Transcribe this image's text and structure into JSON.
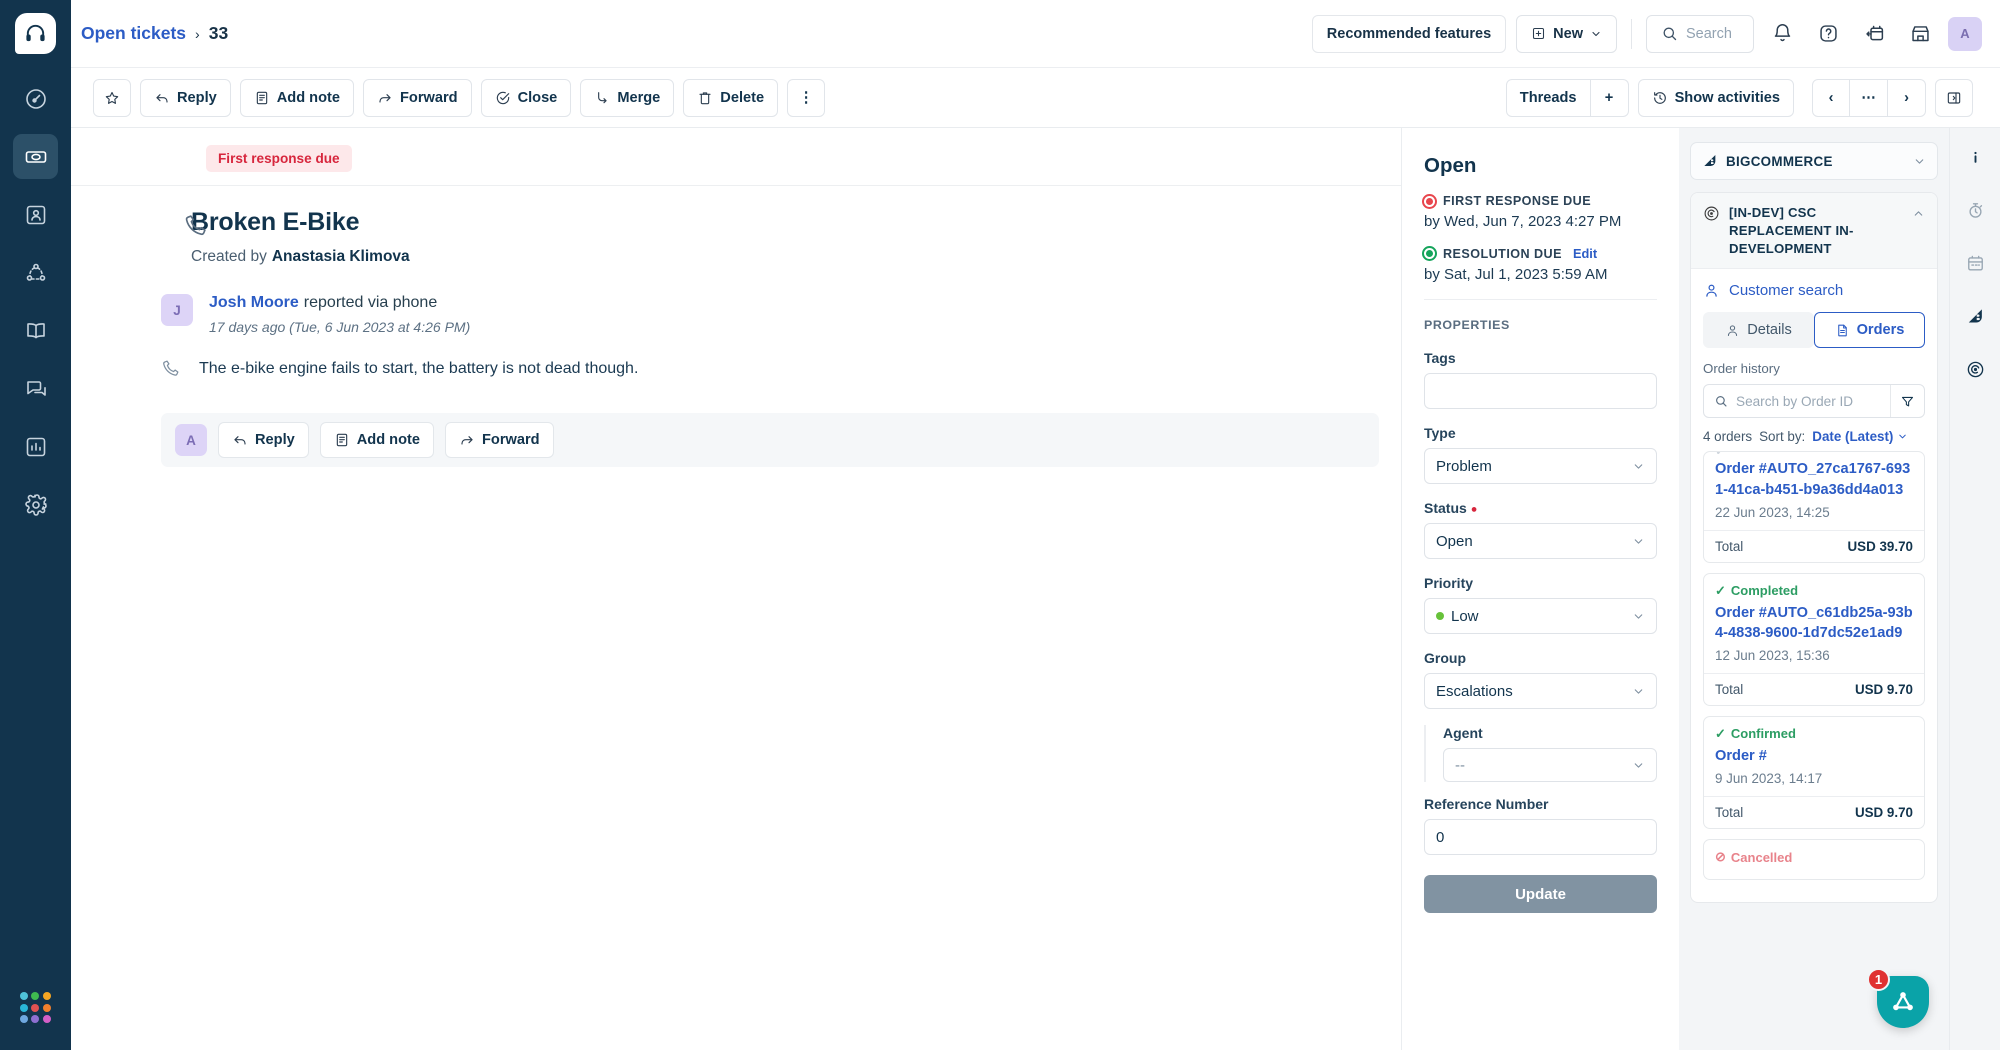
{
  "colors": {
    "brand_navy": "#12344d",
    "link_blue": "#2c5cc5",
    "danger_red": "#d7263d",
    "success_green": "#15a45b",
    "fab_teal": "#0aa3a8",
    "badge_red": "#e03131"
  },
  "sidebar": {
    "logo_icon": "headset-icon",
    "items": [
      {
        "name": "dashboard",
        "icon": "speedometer-icon",
        "active": false
      },
      {
        "name": "tickets",
        "icon": "ticket-icon",
        "active": true
      },
      {
        "name": "contacts",
        "icon": "contact-card-icon",
        "active": false
      },
      {
        "name": "customers",
        "icon": "network-icon",
        "active": false
      },
      {
        "name": "solutions",
        "icon": "book-icon",
        "active": false
      },
      {
        "name": "chat",
        "icon": "chat-bubbles-icon",
        "active": false
      },
      {
        "name": "analytics",
        "icon": "bar-chart-icon",
        "active": false
      },
      {
        "name": "admin",
        "icon": "gear-icon",
        "active": false
      }
    ],
    "apps_launcher": {
      "name": "apps-launcher",
      "dot_colors": [
        "#4fc3d9",
        "#3fb950",
        "#f5a623",
        "#29b6d8",
        "#e05252",
        "#f07f2d",
        "#6fa8e0",
        "#8e6fd1",
        "#d45fc7"
      ]
    }
  },
  "topbar": {
    "breadcrumb": {
      "parent": "Open tickets",
      "separator": "›",
      "current": "33"
    },
    "recommended_features_label": "Recommended features",
    "new_label": "New",
    "search_placeholder": "Search",
    "icons": [
      "bell-icon",
      "help-circle-icon",
      "calendar-ticket-icon",
      "storefront-icon"
    ],
    "avatar_initial": "A"
  },
  "actionbar": {
    "star_label": "",
    "buttons": [
      {
        "label": "Reply",
        "icon": "reply-arrow-icon"
      },
      {
        "label": "Add note",
        "icon": "note-icon"
      },
      {
        "label": "Forward",
        "icon": "forward-arrow-icon"
      },
      {
        "label": "Close",
        "icon": "check-circle-icon"
      },
      {
        "label": "Merge",
        "icon": "merge-icon"
      },
      {
        "label": "Delete",
        "icon": "trash-icon"
      }
    ],
    "overflow_label": "⋮",
    "threads_label": "Threads",
    "add_thread_label": "+",
    "show_activities_label": "Show activities",
    "prev_label": "‹",
    "more_label": "⋯",
    "next_label": "›",
    "collapse_panel_icon": "panel-collapse-icon"
  },
  "ticket": {
    "sla_pill": "First response due",
    "channel_icon": "phone-icon",
    "title": "Broken E-Bike",
    "created_by_label": "Created by",
    "created_by_name": "Anastasia Klimova",
    "message": {
      "avatar_initial": "J",
      "author": "Josh Moore",
      "via": "reported via phone",
      "timestamp": "17 days ago (Tue, 6 Jun 2023 at 4:26 PM)",
      "channel_icon": "phone-icon",
      "body": "The e-bike engine fails to start, the battery is not dead though."
    },
    "reply_bar": {
      "avatar_initial": "A",
      "buttons": [
        {
          "label": "Reply",
          "icon": "reply-arrow-icon"
        },
        {
          "label": "Add note",
          "icon": "note-icon"
        },
        {
          "label": "Forward",
          "icon": "forward-arrow-icon"
        }
      ]
    }
  },
  "properties": {
    "status_heading": "Open",
    "first_response": {
      "label": "FIRST RESPONSE DUE",
      "value": "by Wed, Jun 7, 2023 4:27 PM",
      "dot_color": "#e8464d"
    },
    "resolution": {
      "label": "RESOLUTION DUE",
      "edit_label": "Edit",
      "value": "by Sat, Jul 1, 2023 5:59 AM",
      "dot_color": "#15a45b"
    },
    "section_title": "PROPERTIES",
    "fields": {
      "tags": {
        "label": "Tags",
        "value": ""
      },
      "type": {
        "label": "Type",
        "value": "Problem"
      },
      "status": {
        "label": "Status",
        "required": true,
        "value": "Open"
      },
      "priority": {
        "label": "Priority",
        "value": "Low",
        "dot_color": "#67c23a"
      },
      "group": {
        "label": "Group",
        "value": "Escalations"
      },
      "agent": {
        "label": "Agent",
        "value": "--"
      },
      "reference_number": {
        "label": "Reference Number",
        "value": "0"
      }
    },
    "update_label": "Update"
  },
  "app_panel": {
    "app_selector": {
      "label": "BIGCOMMERCE",
      "icon": "bigcommerce-icon"
    },
    "card_title": "[IN-DEV] CSC REPLACEMENT IN-DEVELOPMENT",
    "card_icon": "spiral-icon",
    "customer_search_label": "Customer search",
    "tabs": [
      {
        "label": "Details",
        "icon": "person-icon",
        "active": false
      },
      {
        "label": "Orders",
        "icon": "document-icon",
        "active": true
      }
    ],
    "order_history_label": "Order history",
    "search_placeholder": "Search by Order ID",
    "filter_icon": "funnel-icon",
    "order_count": "4 orders",
    "sort_label": "Sort by:",
    "sort_value": "Date (Latest)",
    "orders": [
      {
        "status": "",
        "status_type": "clipped",
        "order_id": "Order #AUTO_27ca1767-6931-41ca-b451-b9a36dd4a013",
        "date": "22 Jun 2023, 14:25",
        "total_label": "Total",
        "total": "USD 39.70"
      },
      {
        "status": "Completed",
        "status_type": "green",
        "order_id": "Order #AUTO_c61db25a-93b4-4838-9600-1d7dc52e1ad9",
        "date": "12 Jun 2023, 15:36",
        "total_label": "Total",
        "total": "USD 9.70"
      },
      {
        "status": "Confirmed",
        "status_type": "green",
        "order_id": "Order #",
        "date": "9 Jun 2023, 14:17",
        "total_label": "Total",
        "total": "USD 9.70"
      },
      {
        "status": "Cancelled",
        "status_type": "red",
        "order_id": "",
        "date": "",
        "total_label": "",
        "total": ""
      }
    ]
  },
  "far_rail": {
    "items": [
      {
        "name": "info",
        "icon": "info-icon",
        "active": true
      },
      {
        "name": "time-tracking",
        "icon": "stopwatch-icon",
        "active": false
      },
      {
        "name": "calendar",
        "icon": "calendar-icon",
        "active": false
      },
      {
        "name": "bigcommerce",
        "icon": "bigcommerce-icon",
        "active": true
      },
      {
        "name": "integration",
        "icon": "spiral-icon",
        "active": true
      }
    ]
  },
  "fab": {
    "icon": "triangle-network-icon",
    "badge": "1"
  }
}
